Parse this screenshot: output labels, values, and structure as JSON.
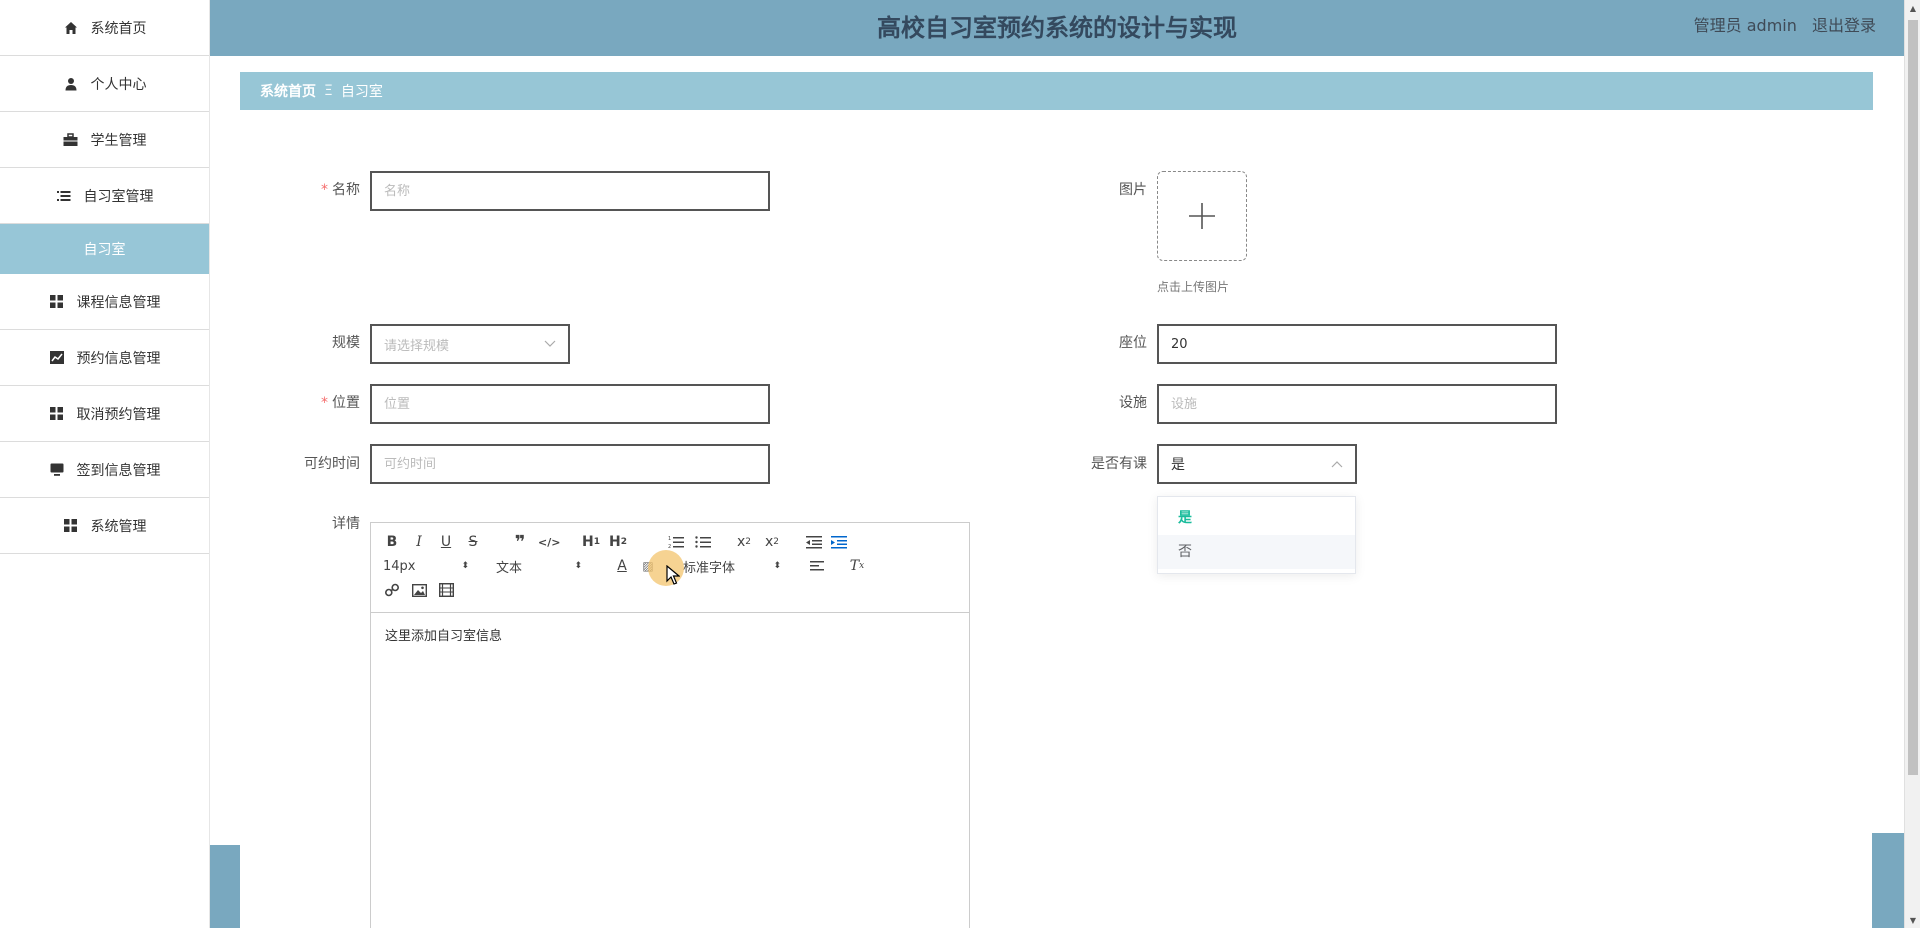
{
  "header": {
    "title": "高校自习室预约系统的设计与实现",
    "role_user": "管理员 admin",
    "logout": "退出登录"
  },
  "sidebar": {
    "items": [
      {
        "label": "系统首页",
        "icon": "home-icon"
      },
      {
        "label": "个人中心",
        "icon": "user-icon"
      },
      {
        "label": "学生管理",
        "icon": "briefcase-icon"
      },
      {
        "label": "自习室管理",
        "icon": "list-icon"
      },
      {
        "label": "课程信息管理",
        "icon": "grid-icon"
      },
      {
        "label": "预约信息管理",
        "icon": "chart-icon"
      },
      {
        "label": "取消预约管理",
        "icon": "grid-icon"
      },
      {
        "label": "签到信息管理",
        "icon": "monitor-icon"
      },
      {
        "label": "系统管理",
        "icon": "grid-icon"
      }
    ],
    "active_sub": "自习室"
  },
  "breadcrumb": {
    "home": "系统首页",
    "separator": "Ξ",
    "current": "自习室"
  },
  "form": {
    "name_label": "名称",
    "name_placeholder": "名称",
    "image_label": "图片",
    "upload_tip": "点击上传图片",
    "scale_label": "规模",
    "scale_placeholder": "请选择规模",
    "seat_label": "座位",
    "seat_value": "20",
    "location_label": "位置",
    "location_placeholder": "位置",
    "facility_label": "设施",
    "facility_placeholder": "设施",
    "time_label": "可约时间",
    "time_placeholder": "可约时间",
    "course_label": "是否有课",
    "course_value": "是",
    "course_options": [
      "是",
      "否"
    ],
    "detail_label": "详情"
  },
  "editor": {
    "font_size": "14px",
    "block_type": "文本",
    "font_family": "标准字体",
    "content": "这里添加自习室信息"
  },
  "colors": {
    "header_bg": "#79a8bf",
    "breadcrumb_bg": "#97c6d6",
    "active_sub_bg": "#97c6d7",
    "required": "#f56c6c",
    "selected_option": "#1abc9c"
  }
}
